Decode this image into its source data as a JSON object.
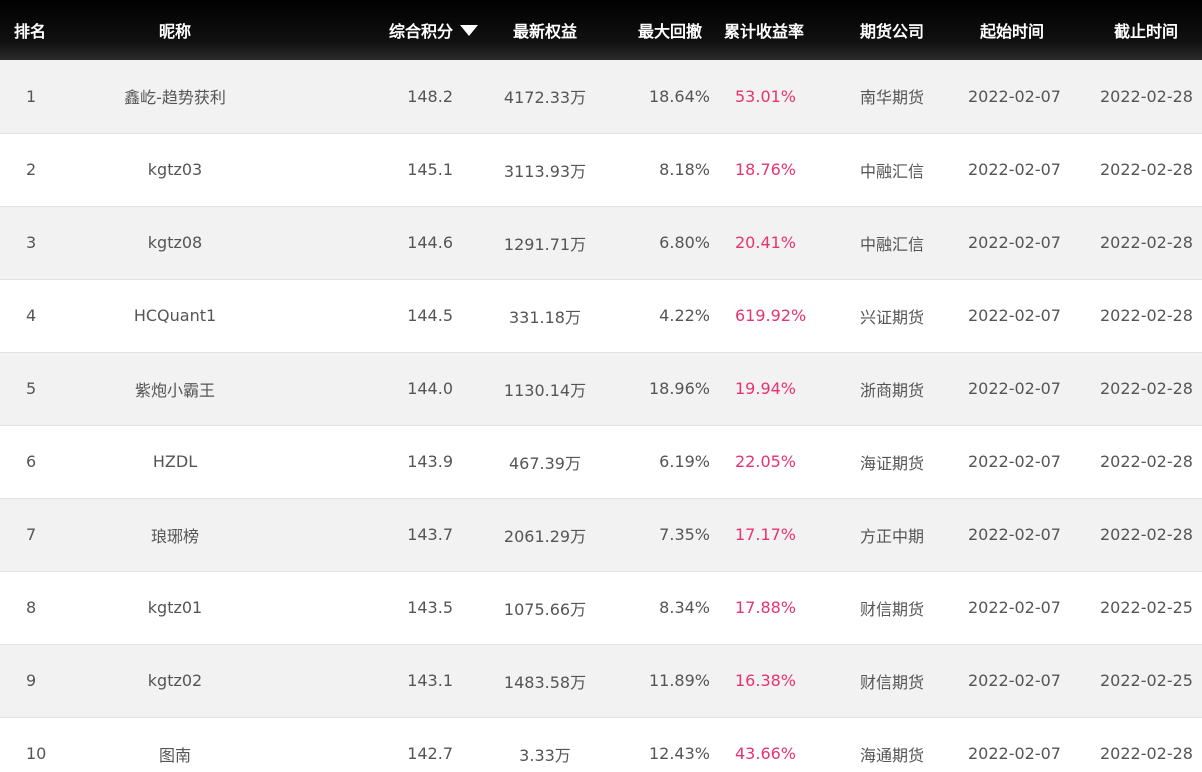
{
  "table": {
    "headers": {
      "rank": "排名",
      "nickname": "昵称",
      "score": "综合积分",
      "equity": "最新权益",
      "drawdown": "最大回撤",
      "return": "累计收益率",
      "company": "期货公司",
      "start": "起始时间",
      "end": "截止时间"
    },
    "sort_icon": "caret-down-icon",
    "colors": {
      "header_bg": "#000000",
      "odd_row_bg": "#f2f2f2",
      "even_row_bg": "#ffffff",
      "return_color": "#e8336f",
      "text_color": "#555555"
    },
    "rows": [
      {
        "rank": "1",
        "nickname": "鑫屹-趋势获利",
        "score": "148.2",
        "equity": "4172.33万",
        "drawdown": "18.64%",
        "return": "53.01%",
        "company": "南华期货",
        "start": "2022-02-07",
        "end": "2022-02-28"
      },
      {
        "rank": "2",
        "nickname": "kgtz03",
        "score": "145.1",
        "equity": "3113.93万",
        "drawdown": "8.18%",
        "return": "18.76%",
        "company": "中融汇信",
        "start": "2022-02-07",
        "end": "2022-02-28"
      },
      {
        "rank": "3",
        "nickname": "kgtz08",
        "score": "144.6",
        "equity": "1291.71万",
        "drawdown": "6.80%",
        "return": "20.41%",
        "company": "中融汇信",
        "start": "2022-02-07",
        "end": "2022-02-28"
      },
      {
        "rank": "4",
        "nickname": "HCQuant1",
        "score": "144.5",
        "equity": "331.18万",
        "drawdown": "4.22%",
        "return": "619.92%",
        "company": "兴证期货",
        "start": "2022-02-07",
        "end": "2022-02-28"
      },
      {
        "rank": "5",
        "nickname": "紫炮小霸王",
        "score": "144.0",
        "equity": "1130.14万",
        "drawdown": "18.96%",
        "return": "19.94%",
        "company": "浙商期货",
        "start": "2022-02-07",
        "end": "2022-02-28"
      },
      {
        "rank": "6",
        "nickname": "HZDL",
        "score": "143.9",
        "equity": "467.39万",
        "drawdown": "6.19%",
        "return": "22.05%",
        "company": "海证期货",
        "start": "2022-02-07",
        "end": "2022-02-28"
      },
      {
        "rank": "7",
        "nickname": "琅琊榜",
        "score": "143.7",
        "equity": "2061.29万",
        "drawdown": "7.35%",
        "return": "17.17%",
        "company": "方正中期",
        "start": "2022-02-07",
        "end": "2022-02-28"
      },
      {
        "rank": "8",
        "nickname": "kgtz01",
        "score": "143.5",
        "equity": "1075.66万",
        "drawdown": "8.34%",
        "return": "17.88%",
        "company": "财信期货",
        "start": "2022-02-07",
        "end": "2022-02-25"
      },
      {
        "rank": "9",
        "nickname": "kgtz02",
        "score": "143.1",
        "equity": "1483.58万",
        "drawdown": "11.89%",
        "return": "16.38%",
        "company": "财信期货",
        "start": "2022-02-07",
        "end": "2022-02-25"
      },
      {
        "rank": "10",
        "nickname": "图南",
        "score": "142.7",
        "equity": "3.33万",
        "drawdown": "12.43%",
        "return": "43.66%",
        "company": "海通期货",
        "start": "2022-02-07",
        "end": "2022-02-28"
      }
    ]
  }
}
